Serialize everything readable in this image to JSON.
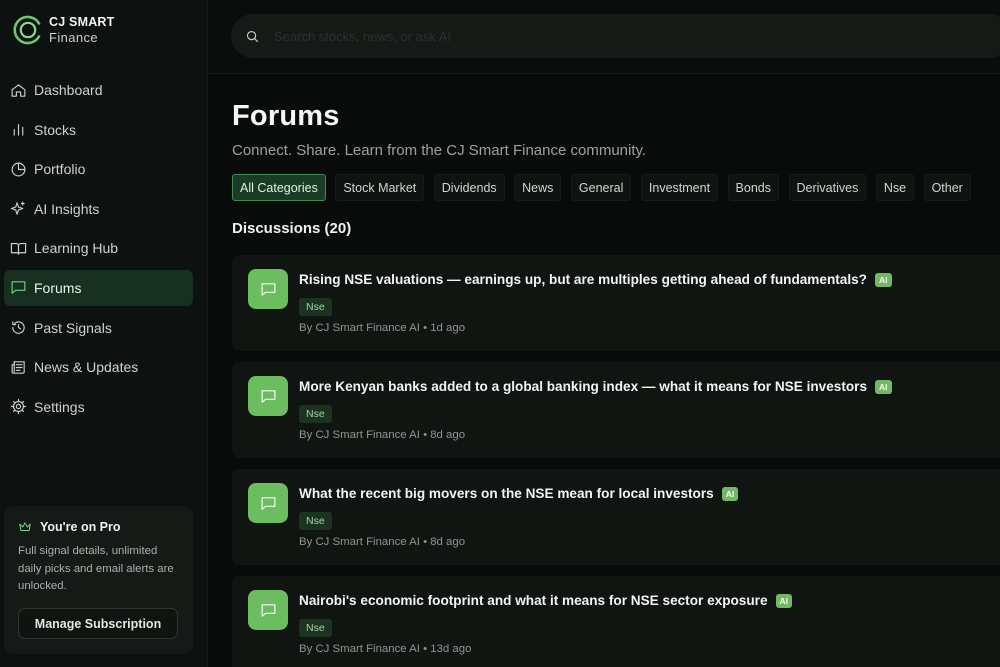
{
  "brand": {
    "line1": "CJ SMART",
    "line2": "Finance"
  },
  "search": {
    "placeholder": "Search stocks, news, or ask AI"
  },
  "sidebar": {
    "items": [
      {
        "label": "Dashboard",
        "icon": "home-icon",
        "active": false
      },
      {
        "label": "Stocks",
        "icon": "bar-chart-icon",
        "active": false
      },
      {
        "label": "Portfolio",
        "icon": "pie-chart-icon",
        "active": false
      },
      {
        "label": "AI Insights",
        "icon": "sparkles-icon",
        "active": false
      },
      {
        "label": "Learning Hub",
        "icon": "book-icon",
        "active": false
      },
      {
        "label": "Forums",
        "icon": "chat-icon",
        "active": true
      },
      {
        "label": "Past Signals",
        "icon": "history-icon",
        "active": false
      },
      {
        "label": "News & Updates",
        "icon": "newspaper-icon",
        "active": false
      },
      {
        "label": "Settings",
        "icon": "gear-icon",
        "active": false
      }
    ]
  },
  "pro": {
    "title": "You're on Pro",
    "icon": "crown-icon",
    "text": "Full signal details, unlimited daily picks and email alerts are unlocked.",
    "button": "Manage Subscription"
  },
  "main": {
    "title": "Forums",
    "subtitle": "Connect. Share. Learn from the CJ Smart Finance community.",
    "categories": [
      "All Categories",
      "Stock Market",
      "Dividends",
      "News",
      "General",
      "Investment",
      "Bonds",
      "Derivatives",
      "Nse",
      "Other"
    ],
    "active_category": "All Categories",
    "discussions_label": "Discussions (20)",
    "threads": [
      {
        "title": "Rising NSE valuations — earnings up, but are multiples getting ahead of fundamentals?",
        "badge": "AI",
        "tag": "Nse",
        "meta": "By CJ Smart Finance AI • 1d ago"
      },
      {
        "title": "More Kenyan banks added to a global banking index — what it means for NSE investors",
        "badge": "AI",
        "tag": "Nse",
        "meta": "By CJ Smart Finance AI • 8d ago"
      },
      {
        "title": "What the recent big movers on the NSE mean for local investors",
        "badge": "AI",
        "tag": "Nse",
        "meta": "By CJ Smart Finance AI • 8d ago"
      },
      {
        "title": "Nairobi's economic footprint and what it means for NSE sector exposure",
        "badge": "AI",
        "tag": "Nse",
        "meta": "By CJ Smart Finance AI • 13d ago"
      }
    ]
  },
  "colors": {
    "accent": "#6cbd5f",
    "active_nav_bg": "#173021",
    "background": "#090b0a"
  }
}
